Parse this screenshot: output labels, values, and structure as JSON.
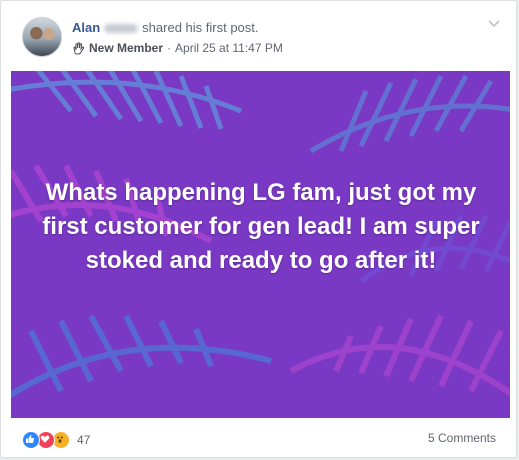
{
  "post": {
    "author": "Alan",
    "action": "shared his first post.",
    "badge": "New Member",
    "separator": "·",
    "timestamp": "April 25 at 11:47 PM",
    "body_text": "Whats happening LG fam, just got my first customer for gen lead! I am super stoked and ready to go after it!",
    "reaction_count": "47",
    "comments_label": "5 Comments"
  },
  "colors": {
    "link_blue": "#385898",
    "post_bg": "#7a38c0",
    "like": "#2d88ff",
    "love": "#f33e58",
    "wow": "#f7b125"
  },
  "icons": {
    "badge": "waving-hand-icon",
    "menu": "chevron-down-icon",
    "reactions": [
      "like-icon",
      "love-icon",
      "wow-icon"
    ]
  }
}
